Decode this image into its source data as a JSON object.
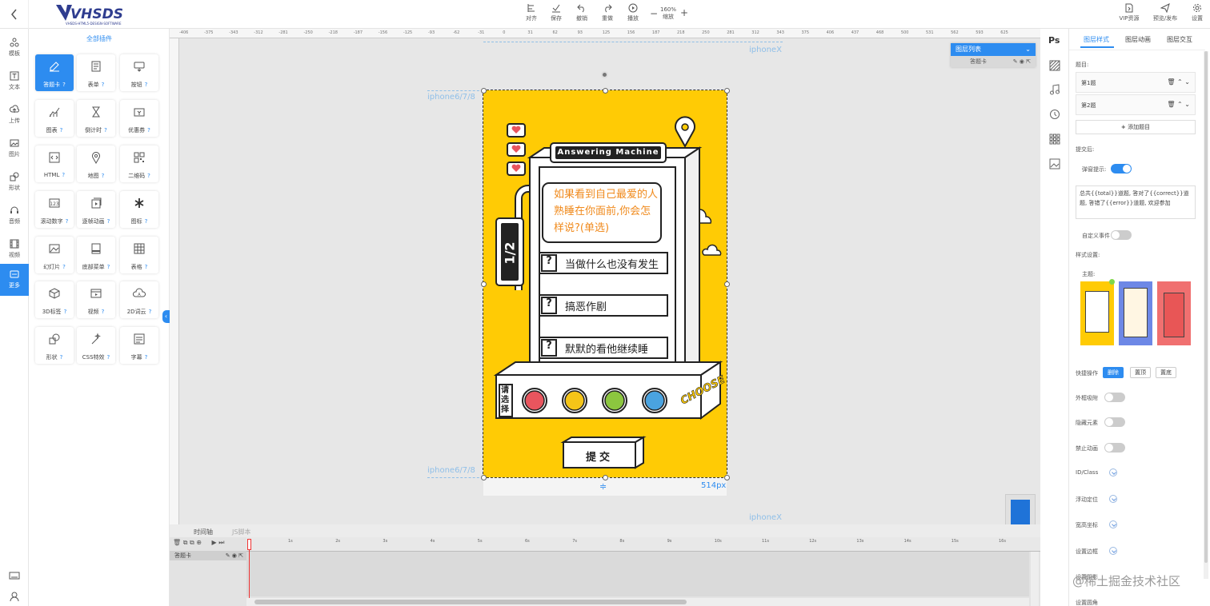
{
  "header": {
    "logo_text": "VHSDS",
    "logo_sub": "VHSDS-HTML5-DESIGN-SOFTWARE",
    "tools": [
      {
        "label": "对齐",
        "icon": "align-icon"
      },
      {
        "label": "保存",
        "icon": "save-icon"
      },
      {
        "label": "撤销",
        "icon": "undo-icon"
      },
      {
        "label": "重做",
        "icon": "redo-icon"
      },
      {
        "label": "播放",
        "icon": "play-icon"
      }
    ],
    "zoom_value": "160%",
    "zoom_label": "缩放",
    "right_tools": [
      {
        "label": "VIP资源",
        "icon": "vip-icon"
      },
      {
        "label": "预览/发布",
        "icon": "publish-icon"
      },
      {
        "label": "设置",
        "icon": "gear-icon"
      }
    ]
  },
  "leftbar": {
    "items": [
      {
        "label": "模板",
        "icon": "template-icon"
      },
      {
        "label": "文本",
        "icon": "text-icon"
      },
      {
        "label": "上传",
        "icon": "upload-icon"
      },
      {
        "label": "图片",
        "icon": "image-icon"
      },
      {
        "label": "形状",
        "icon": "shape-icon"
      },
      {
        "label": "音频",
        "icon": "audio-icon"
      },
      {
        "label": "视频",
        "icon": "video-icon"
      },
      {
        "label": "更多",
        "icon": "more-icon"
      }
    ]
  },
  "plugins": {
    "title": "全部插件",
    "items": [
      {
        "label": "答题卡",
        "icon": "edit-icon"
      },
      {
        "label": "表单",
        "icon": "form-icon"
      },
      {
        "label": "按钮",
        "icon": "button-icon"
      },
      {
        "label": "图表",
        "icon": "chart-icon"
      },
      {
        "label": "倒计时",
        "icon": "hourglass-icon"
      },
      {
        "label": "优惠券",
        "icon": "coupon-icon"
      },
      {
        "label": "HTML",
        "icon": "code-icon"
      },
      {
        "label": "地图",
        "icon": "map-pin-icon"
      },
      {
        "label": "二维码",
        "icon": "qrcode-icon"
      },
      {
        "label": "滚动数字",
        "icon": "number-icon"
      },
      {
        "label": "逐帧动画",
        "icon": "frame-icon"
      },
      {
        "label": "图标",
        "icon": "asterisk-icon"
      },
      {
        "label": "幻灯片",
        "icon": "slides-icon"
      },
      {
        "label": "底部菜单",
        "icon": "bottom-menu-icon"
      },
      {
        "label": "表格",
        "icon": "table-icon"
      },
      {
        "label": "3D标签",
        "icon": "cube-icon"
      },
      {
        "label": "视频",
        "icon": "video-icon"
      },
      {
        "label": "2D词云",
        "icon": "cloud-icon"
      },
      {
        "label": "形状",
        "icon": "shape-icon"
      },
      {
        "label": "CSS特效",
        "icon": "magic-icon"
      },
      {
        "label": "字幕",
        "icon": "subtitle-icon"
      }
    ],
    "help_mark": "?"
  },
  "canvas": {
    "ruler_ticks": [
      "-406",
      "-375",
      "-343",
      "-312",
      "-281",
      "-250",
      "-218",
      "-187",
      "-156",
      "-125",
      "-93",
      "-62",
      "-31",
      "0",
      "31",
      "62",
      "93",
      "125",
      "156",
      "187",
      "218",
      "250",
      "281",
      "312",
      "343",
      "375",
      "406",
      "437",
      "468",
      "500",
      "531",
      "562",
      "593",
      "625"
    ],
    "guide_top": "iphoneX",
    "guide_left_top": "iphone6/7/8",
    "guide_left_bottom": "iphone6/7/8",
    "guide_bottom": "iphoneX",
    "width_label": "514px",
    "machine_title": "Answering Machine",
    "progress": "1/2",
    "question": "如果看到自己最爱的人熟睡在你面前,你会怎样说?(单选)",
    "options": [
      {
        "mark": "?",
        "text": "当做什么也没有发生"
      },
      {
        "mark": "?",
        "text": "搞恶作剧"
      },
      {
        "mark": "?",
        "text": "默默的看他继续睡"
      }
    ],
    "select_label": "请选择",
    "choose_label": "CHOOSE",
    "submit_label": "提交",
    "button_colors": [
      "#e9555e",
      "#f5c518",
      "#8cc63f",
      "#4aa3e0"
    ],
    "accent_yellow": "#ffcb05"
  },
  "layers": {
    "title": "图层列表",
    "item": "答题卡"
  },
  "timeline": {
    "tabs": [
      "时间轴",
      "JS脚本"
    ],
    "layer_name": "答题卡",
    "ticks": [
      "1s",
      "2s",
      "3s",
      "4s",
      "5s",
      "6s",
      "7s",
      "8s",
      "9s",
      "10s",
      "11s",
      "12s",
      "13s",
      "14s",
      "15s",
      "16s"
    ]
  },
  "rtools": {
    "ps_label": "Ps"
  },
  "props": {
    "tabs": [
      "图层样式",
      "图层动画",
      "图层交互"
    ],
    "questions_label": "题目:",
    "questions": [
      "第1题",
      "第2题"
    ],
    "add_question": "添加题目",
    "after_submit": "提交后:",
    "popup_tip": "弹窗提示:",
    "popup_text": "总共{{total}}道题, 答对了{{correct}}道题, 答错了{{error}}道题, 欢迎参加",
    "custom_event": "自定义事件",
    "style_settings": "样式设置:",
    "theme_label": "主题:",
    "quick_ops": "快捷操作",
    "quick_buttons": [
      "删除",
      "置顶",
      "置底"
    ],
    "toggles": [
      "外框吸附",
      "隐藏元素",
      "禁止动画"
    ],
    "collapsibles": [
      "ID/Class",
      "浮动定位",
      "宽高坐标",
      "设置边框",
      "设置阴影",
      "设置圆角"
    ]
  },
  "watermark": "@稀土掘金技术社区"
}
